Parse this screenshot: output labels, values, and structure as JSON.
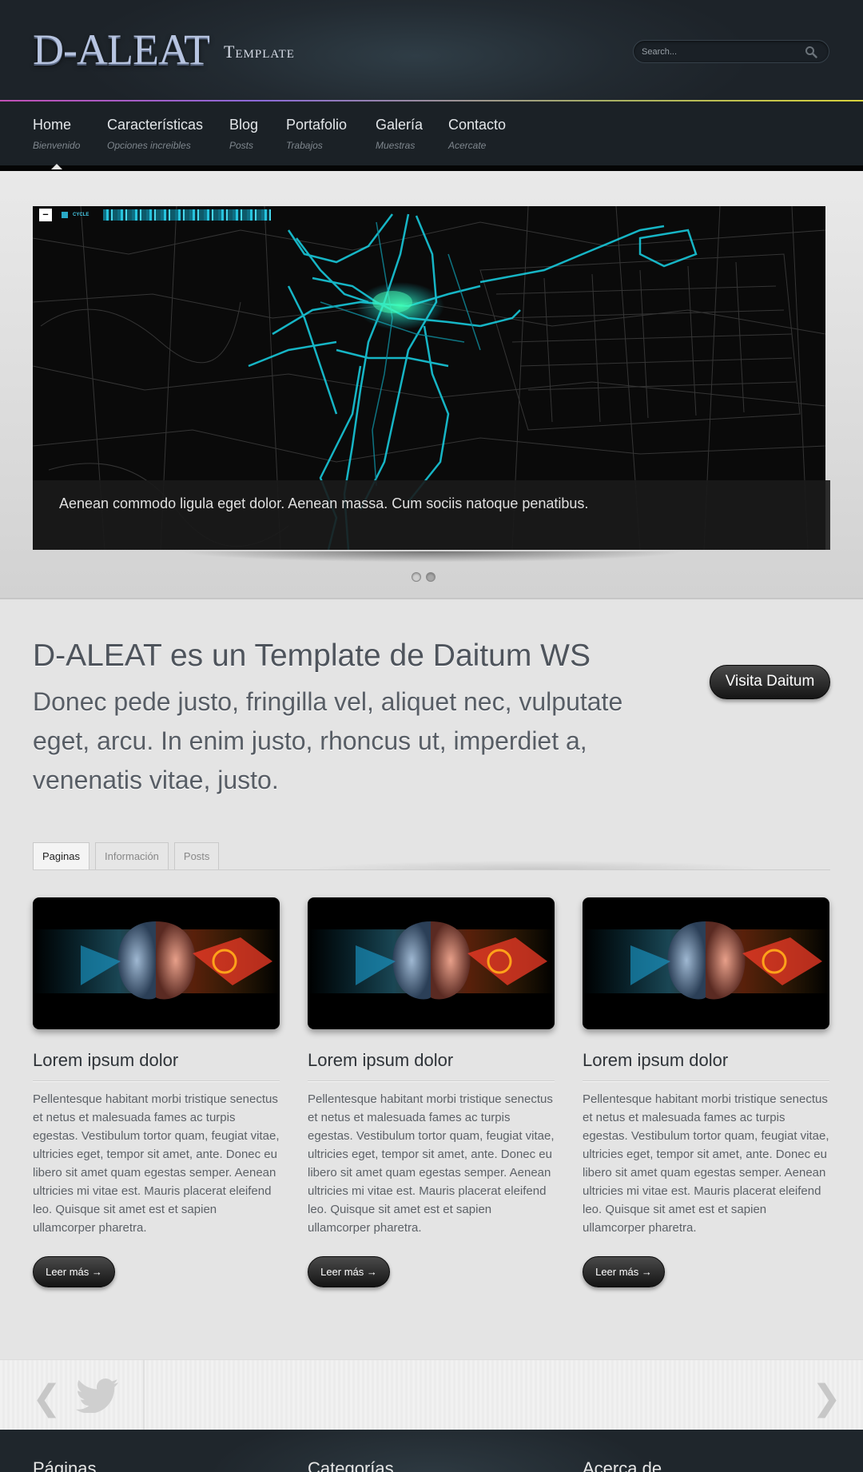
{
  "header": {
    "logo_main": "D-ALEAT",
    "logo_sub": "Template",
    "search_placeholder": "Search..."
  },
  "nav": [
    {
      "label": "Home",
      "sub": "Bienvenido"
    },
    {
      "label": "Características",
      "sub": "Opciones increibles"
    },
    {
      "label": "Blog",
      "sub": "Posts"
    },
    {
      "label": "Portafolio",
      "sub": "Trabajos"
    },
    {
      "label": "Galería",
      "sub": "Muestras"
    },
    {
      "label": "Contacto",
      "sub": "Acercate"
    }
  ],
  "slider": {
    "map_toolbar_minus": "–",
    "map_toolbar_label": "CYCLE",
    "caption": "Aenean commodo ligula eget dolor. Aenean massa. Cum sociis natoque penatibus.",
    "pages": 2,
    "active_page": 2
  },
  "intro": {
    "title": "D-ALEAT es un Template de Daitum WS",
    "text": "Donec pede justo, fringilla vel, aliquet nec, vulputate eget, arcu. In enim justo, rhoncus ut, imperdiet a, venenatis vitae, justo.",
    "button": "Visita Daitum"
  },
  "tabs": [
    {
      "label": "Paginas",
      "active": true
    },
    {
      "label": "Información",
      "active": false
    },
    {
      "label": "Posts",
      "active": false
    }
  ],
  "cards": [
    {
      "title": "Lorem ipsum dolor",
      "text": "Pellentesque habitant morbi tristique senectus et netus et malesuada fames ac turpis egestas. Vestibulum tortor quam, feugiat vitae, ultricies eget, tempor sit amet, ante. Donec eu libero sit amet quam egestas semper. Aenean ultricies mi vitae est. Mauris placerat eleifend leo. Quisque sit amet est et sapien ullamcorper pharetra.",
      "button": "Leer más →"
    },
    {
      "title": "Lorem ipsum dolor",
      "text": "Pellentesque habitant morbi tristique senectus et netus et malesuada fames ac turpis egestas. Vestibulum tortor quam, feugiat vitae, ultricies eget, tempor sit amet, ante. Donec eu libero sit amet quam egestas semper. Aenean ultricies mi vitae est. Mauris placerat eleifend leo. Quisque sit amet est et sapien ullamcorper pharetra.",
      "button": "Leer más →"
    },
    {
      "title": "Lorem ipsum dolor",
      "text": "Pellentesque habitant morbi tristique senectus et netus et malesuada fames ac turpis egestas. Vestibulum tortor quam, feugiat vitae, ultricies eget, tempor sit amet, ante. Donec eu libero sit amet quam egestas semper. Aenean ultricies mi vitae est. Mauris placerat eleifend leo. Quisque sit amet est et sapien ullamcorper pharetra.",
      "button": "Leer más →"
    }
  ],
  "twitter": {
    "prev": "❮",
    "next": "❯",
    "icon": "twitter-bird-icon"
  },
  "footer": {
    "headings": [
      "Páginas",
      "Categorías",
      "Acerca de"
    ]
  },
  "colors": {
    "header_bg": "#222a31",
    "nav_bg": "#1b2126",
    "map_route": "#19d3e6",
    "button_dark": "#151515"
  }
}
